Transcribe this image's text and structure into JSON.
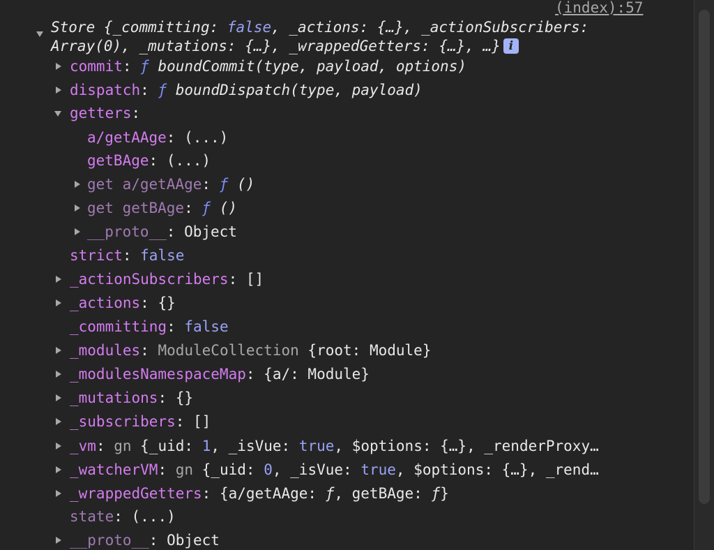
{
  "source_link": "(index):57",
  "summary": {
    "line1_prefix": "Store {",
    "line1_k1": "_committing",
    "line1_v1": "false",
    "line1_k2": "_actions",
    "line1_v2": "{…}",
    "line1_k3": "_actionSubscribers",
    "line2_v3": "Array(0)",
    "line2_k4": "_mutations",
    "line2_v4": "{…}",
    "line2_k5": "_wrappedGetters",
    "line2_v5": "{…}",
    "line2_tail": "…}",
    "info_label": "i"
  },
  "rows": {
    "commit": {
      "key": "commit",
      "kw": "ƒ",
      "value": "boundCommit(type, payload, options)"
    },
    "dispatch": {
      "key": "dispatch",
      "kw": "ƒ",
      "value": "boundDispatch(type, payload)"
    },
    "getters": {
      "key": "getters"
    },
    "getter_a": {
      "key": "a/getAAge",
      "value": "(...)"
    },
    "getter_b": {
      "key": "getBAge",
      "value": "(...)"
    },
    "get_a": {
      "key": "get a/getAAge",
      "kw": "ƒ",
      "value": "()"
    },
    "get_b": {
      "key": "get getBAge",
      "kw": "ƒ",
      "value": "()"
    },
    "getters_proto": {
      "key": "__proto__",
      "value": "Object"
    },
    "strict": {
      "key": "strict",
      "value": "false"
    },
    "action_subscribers": {
      "key": "_actionSubscribers",
      "value": "[]"
    },
    "actions": {
      "key": "_actions",
      "value": "{}"
    },
    "committing": {
      "key": "_committing",
      "value": "false"
    },
    "modules": {
      "key": "_modules",
      "class_name": "ModuleCollection",
      "v_open": "{",
      "v_key": "root",
      "v_val": "Module",
      "v_close": "}"
    },
    "modules_ns_map": {
      "key": "_modulesNamespaceMap",
      "v_open": "{",
      "v_key": "a/",
      "v_val": "Module",
      "v_close": "}"
    },
    "mutations": {
      "key": "_mutations",
      "value": "{}"
    },
    "subscribers": {
      "key": "_subscribers",
      "value": "[]"
    },
    "vm": {
      "key": "_vm",
      "class_name": "gn",
      "p1k": "_uid",
      "p1v": "1",
      "p2k": "_isVue",
      "p2v": "true",
      "p3k": "$options",
      "p3v": "{…}",
      "tail": "_renderProxy…"
    },
    "watcher_vm": {
      "key": "_watcherVM",
      "class_name": "gn",
      "p1k": "_uid",
      "p1v": "0",
      "p2k": "_isVue",
      "p2v": "true",
      "p3k": "$options",
      "p3v": "{…}",
      "tail": "_rend…"
    },
    "wrapped_getters": {
      "key": "_wrappedGetters",
      "p1k": "a/getAAge",
      "p1v": "ƒ",
      "p2k": "getBAge",
      "p2v": "ƒ"
    },
    "state": {
      "key": "state",
      "value": "(...)"
    },
    "proto": {
      "key": "__proto__",
      "value": "Object"
    }
  }
}
